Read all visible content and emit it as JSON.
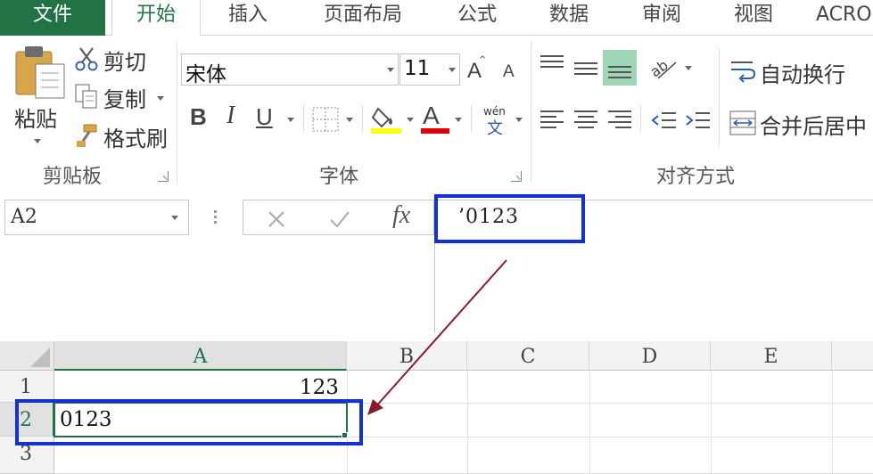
{
  "ribbon_tabs": [
    "文件",
    "开始",
    "插入",
    "页面布局",
    "公式",
    "数据",
    "审阅",
    "视图",
    "ACRO"
  ],
  "clipboard": {
    "paste_label": "粘贴",
    "cut_label": "剪切",
    "copy_label": "复制",
    "format_painter_label": "格式刷",
    "group_label": "剪贴板"
  },
  "font": {
    "font_name": "宋体",
    "font_size": "11",
    "bold_label": "B",
    "italic_label": "I",
    "underline_label": "U",
    "font_color_letter": "A",
    "phonetic_top": "wén",
    "phonetic_bottom": "文",
    "group_label": "字体",
    "fill_color": "#ffff00",
    "font_color": "#e00000"
  },
  "alignment": {
    "wrap_text_label": "自动换行",
    "merge_center_label": "合并后居中",
    "group_label": "对齐方式"
  },
  "formula_bar": {
    "name_box": "A2",
    "fx_label": "fx",
    "formula_value": "’0123"
  },
  "sheet": {
    "columns": [
      "A",
      "B",
      "C",
      "D",
      "E"
    ],
    "rows": [
      "1",
      "2",
      "3"
    ],
    "cells": {
      "A1": "123",
      "A2": "0123"
    }
  },
  "colors": {
    "accent": "#217346",
    "highlight_box": "#1432d4",
    "arrow": "#8b1a2b"
  }
}
